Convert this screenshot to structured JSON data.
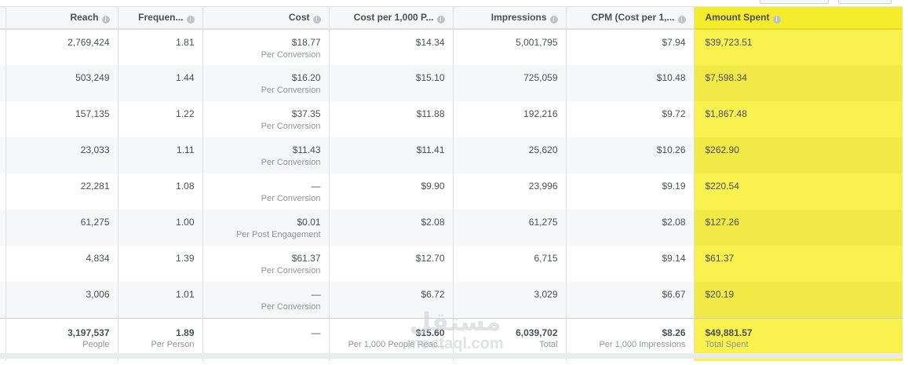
{
  "columns": [
    {
      "label": "Reach",
      "info_icon": "info-icon"
    },
    {
      "label": "Frequen...",
      "info_icon": "info-icon"
    },
    {
      "label": "Cost",
      "info_icon": "info-icon"
    },
    {
      "label": "Cost per 1,000 P...",
      "info_icon": "info-icon"
    },
    {
      "label": "Impressions",
      "info_icon": "info-icon"
    },
    {
      "label": "CPM (Cost per 1,...",
      "info_icon": "info-icon"
    },
    {
      "label": "Amount Spent",
      "info_icon": "info-icon"
    }
  ],
  "info_glyph": "i",
  "rows": [
    {
      "reach": "2,769,424",
      "frequency": "1.81",
      "cost": "$18.77",
      "cost_sub": "Per Conversion",
      "cpp": "$14.34",
      "impressions": "5,001,795",
      "cpm": "$7.94",
      "spent": "$39,723.51"
    },
    {
      "reach": "503,249",
      "frequency": "1.44",
      "cost": "$16.20",
      "cost_sub": "Per Conversion",
      "cpp": "$15.10",
      "impressions": "725,059",
      "cpm": "$10.48",
      "spent": "$7,598.34"
    },
    {
      "reach": "157,135",
      "frequency": "1.22",
      "cost": "$37.35",
      "cost_sub": "Per Conversion",
      "cpp": "$11.88",
      "impressions": "192,216",
      "cpm": "$9.72",
      "spent": "$1,867.48"
    },
    {
      "reach": "23,033",
      "frequency": "1.11",
      "cost": "$11.43",
      "cost_sub": "Per Conversion",
      "cpp": "$11.41",
      "impressions": "25,620",
      "cpm": "$10.26",
      "spent": "$262.90"
    },
    {
      "reach": "22,281",
      "frequency": "1.08",
      "cost": "—",
      "cost_sub": "Per Conversion",
      "cpp": "$9.90",
      "impressions": "23,996",
      "cpm": "$9.19",
      "spent": "$220.54"
    },
    {
      "reach": "61,275",
      "frequency": "1.00",
      "cost": "$0.01",
      "cost_sub": "Per Post Engagement",
      "cpp": "$2.08",
      "impressions": "61,275",
      "cpm": "$2.08",
      "spent": "$127.26"
    },
    {
      "reach": "4,834",
      "frequency": "1.39",
      "cost": "$61.37",
      "cost_sub": "Per Conversion",
      "cpp": "$12.70",
      "impressions": "6,715",
      "cpm": "$9.14",
      "spent": "$61.37"
    },
    {
      "reach": "3,006",
      "frequency": "1.01",
      "cost": "—",
      "cost_sub": "Per Conversion",
      "cpp": "$6.72",
      "impressions": "3,029",
      "cpm": "$6.67",
      "spent": "$20.19"
    }
  ],
  "totals": {
    "reach": "3,197,537",
    "reach_sub": "People",
    "frequency": "1.89",
    "frequency_sub": "Per Person",
    "cost": "—",
    "cpp": "$15.60",
    "cpp_sub": "Per 1,000 People Reac...",
    "impressions": "6,039,702",
    "impressions_sub": "Total",
    "cpm": "$8.26",
    "cpm_sub": "Per 1,000 Impressions",
    "spent": "$49,881.57",
    "spent_sub": "Total Spent"
  },
  "watermark": {
    "arabic": "مستقل",
    "latin": "mostaql.com"
  },
  "colors": {
    "highlight": "#f9f24e",
    "header_bg": "#f6f7f9",
    "border": "#dddfe2",
    "text": "#4b4f56",
    "muted": "#90949c"
  }
}
